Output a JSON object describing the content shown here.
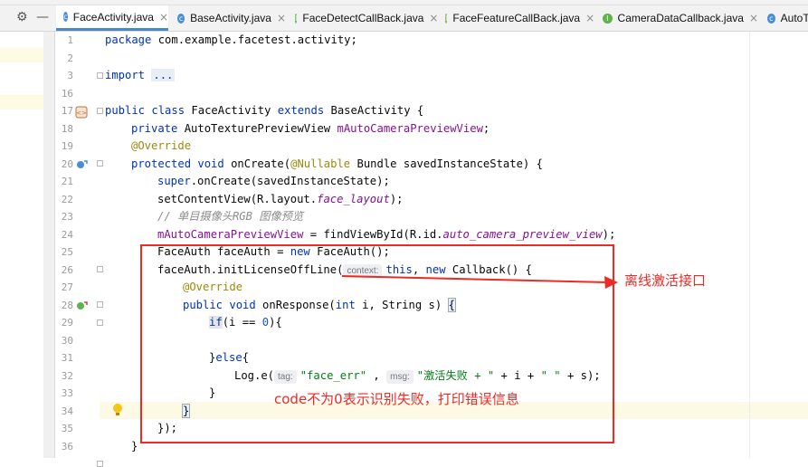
{
  "tabs": [
    {
      "label": "FaceActivity.java",
      "icon": "class-icon",
      "color": "#4a8cd6",
      "active": true
    },
    {
      "label": "BaseActivity.java",
      "icon": "class-icon",
      "color": "#4a8cd6",
      "active": false
    },
    {
      "label": "FaceDetectCallBack.java",
      "icon": "interface-icon",
      "color": "#5fb24c",
      "active": false
    },
    {
      "label": "FaceFeatureCallBack.java",
      "icon": "interface-icon",
      "color": "#5fb24c",
      "active": false
    },
    {
      "label": "CameraDataCallback.java",
      "icon": "interface-icon",
      "color": "#5fb24c",
      "active": false
    },
    {
      "label": "AutoTe",
      "icon": "class-icon",
      "color": "#4a8cd6",
      "active": false
    }
  ],
  "toolbar": {
    "settings_icon": "gear-icon",
    "collapse_icon": "minus-icon"
  },
  "gutter": {
    "line_numbers": [
      "1",
      "2",
      "3",
      "16",
      "17",
      "18",
      "19",
      "20",
      "21",
      "22",
      "23",
      "24",
      "25",
      "26",
      "27",
      "28",
      "29",
      "30",
      "31",
      "32",
      "33",
      "34",
      "35",
      "36"
    ]
  },
  "code": {
    "l1_kw": "package",
    "l1_rest": " com.example.facetest.activity;",
    "l3_kw": "import",
    "l3_fold": "...",
    "l17_kw1": "public class",
    "l17_name": " FaceActivity ",
    "l17_kw2": "extends",
    "l17_base": " BaseActivity {",
    "l18_kw": "private",
    "l18_type": " AutoTexturePreviewView ",
    "l18_field": "mAutoCameraPreviewView",
    "l18_end": ";",
    "l19_ann": "@Override",
    "l20_kw": "protected void",
    "l20_method": " onCreate(",
    "l20_ann": "@Nullable",
    "l20_rest": " Bundle savedInstanceState) {",
    "l21_kw": "super",
    "l21_rest": ".onCreate(savedInstanceState);",
    "l22_a": "setContentView(R.layout.",
    "l22_field": "face_layout",
    "l22_b": ");",
    "l23_comment": "// 单目摄像头RGB 图像预览",
    "l24_field": "mAutoCameraPreviewView",
    "l24_a": " = findViewById(R.id.",
    "l24_id": "auto_camera_preview_view",
    "l24_b": ");",
    "l25_a": "FaceAuth faceAuth = ",
    "l25_kw": "new",
    "l25_b": " FaceAuth();",
    "l26_a": "faceAuth.initLicenseOffLine(",
    "l26_hint": "context:",
    "l26_this": "this",
    "l26_comma": ", ",
    "l26_new": "new",
    "l26_b": " Callback() {",
    "l27_ann": "@Override",
    "l28_kw": "public void",
    "l28_a": " onResponse(",
    "l28_int": "int",
    "l28_b": " i, String s) ",
    "l28_brace": "{",
    "l29_kw": "if",
    "l29_a": "(i == ",
    "l29_num": "0",
    "l29_b": "){",
    "l31_a": "}",
    "l31_kw": "else",
    "l31_b": "{",
    "l32_a": "Log.e(",
    "l32_hint1": "tag:",
    "l32_str1": "\"face_err\"",
    "l32_b": " , ",
    "l32_hint2": "msg:",
    "l32_str2": "\"激活失败 + \"",
    "l32_c": " + i + ",
    "l32_str3": "\" \"",
    "l32_d": " + s);",
    "l33": "}",
    "l34_brace": "}",
    "l35": "});",
    "l36": "}"
  },
  "annotations": {
    "arrow_label": "离线激活接口",
    "box_label": "code不为0表示识别失败，打印错误信息"
  },
  "colors": {
    "annotation_red": "#ee2a24",
    "keyword": "#0033b3",
    "annotation": "#9e880d",
    "field": "#871094",
    "string": "#067d17"
  }
}
